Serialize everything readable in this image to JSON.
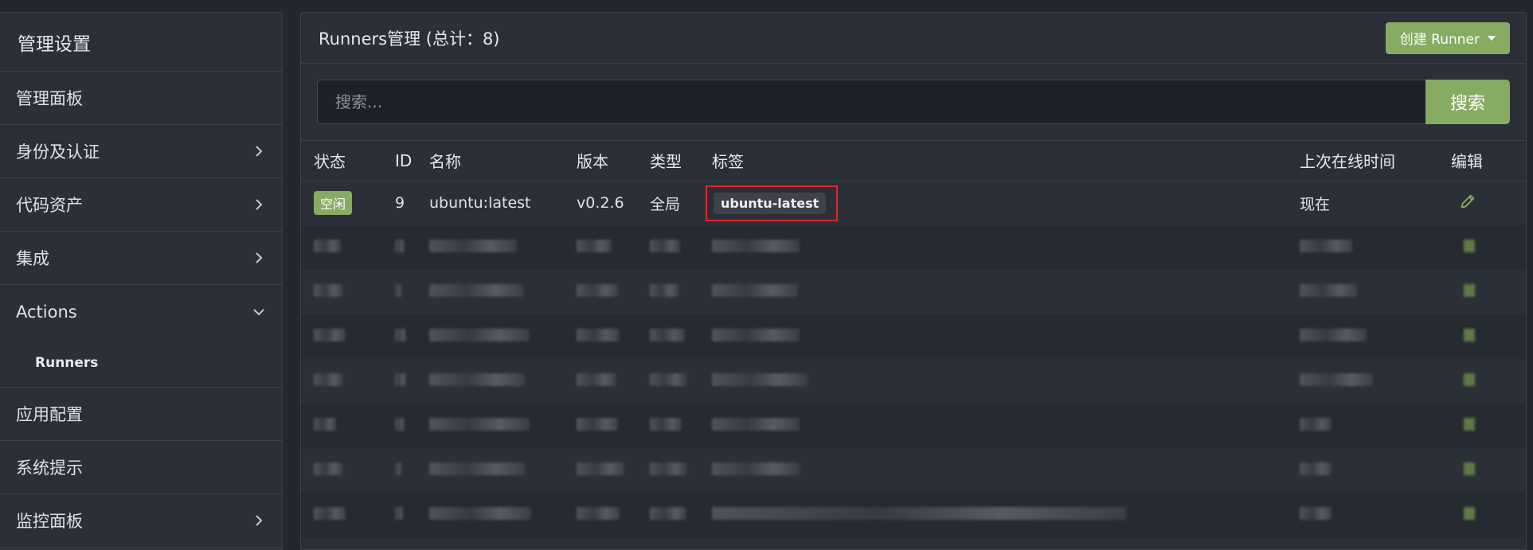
{
  "sidebar": {
    "title": "管理设置",
    "items": [
      {
        "label": "管理面板",
        "has_chevron": false
      },
      {
        "label": "身份及认证",
        "has_chevron": true
      },
      {
        "label": "代码资产",
        "has_chevron": true
      },
      {
        "label": "集成",
        "has_chevron": true
      },
      {
        "label": "Actions",
        "has_chevron": true,
        "expanded": true
      },
      {
        "label": "应用配置",
        "has_chevron": false
      },
      {
        "label": "系统提示",
        "has_chevron": false
      },
      {
        "label": "监控面板",
        "has_chevron": true
      }
    ],
    "subitems": [
      {
        "label": "Runners"
      }
    ]
  },
  "panel": {
    "title": "Runners管理 (总计：8)",
    "create_button": "创建 Runner"
  },
  "search": {
    "placeholder": "搜索...",
    "button": "搜索"
  },
  "table": {
    "headers": {
      "status": "状态",
      "id": "ID",
      "name": "名称",
      "version": "版本",
      "type": "类型",
      "labels": "标签",
      "last_online": "上次在线时间",
      "edit": "编辑"
    },
    "rows": [
      {
        "status": "空闲",
        "id": "9",
        "name": "ubuntu:latest",
        "version": "v0.2.6",
        "type": "全局",
        "label": "ubuntu-latest",
        "last_online": "现在"
      }
    ],
    "redacted_row_count": 7
  },
  "colors": {
    "accent": "#87ab63",
    "highlight_border": "#e2262b",
    "background": "#24272e",
    "panel": "#2b2f37"
  },
  "icons": {
    "chevron": "chevron-right-icon",
    "chevron_open": "chevron-down-icon",
    "edit": "pencil-icon",
    "dropdown": "caret-down-icon"
  }
}
